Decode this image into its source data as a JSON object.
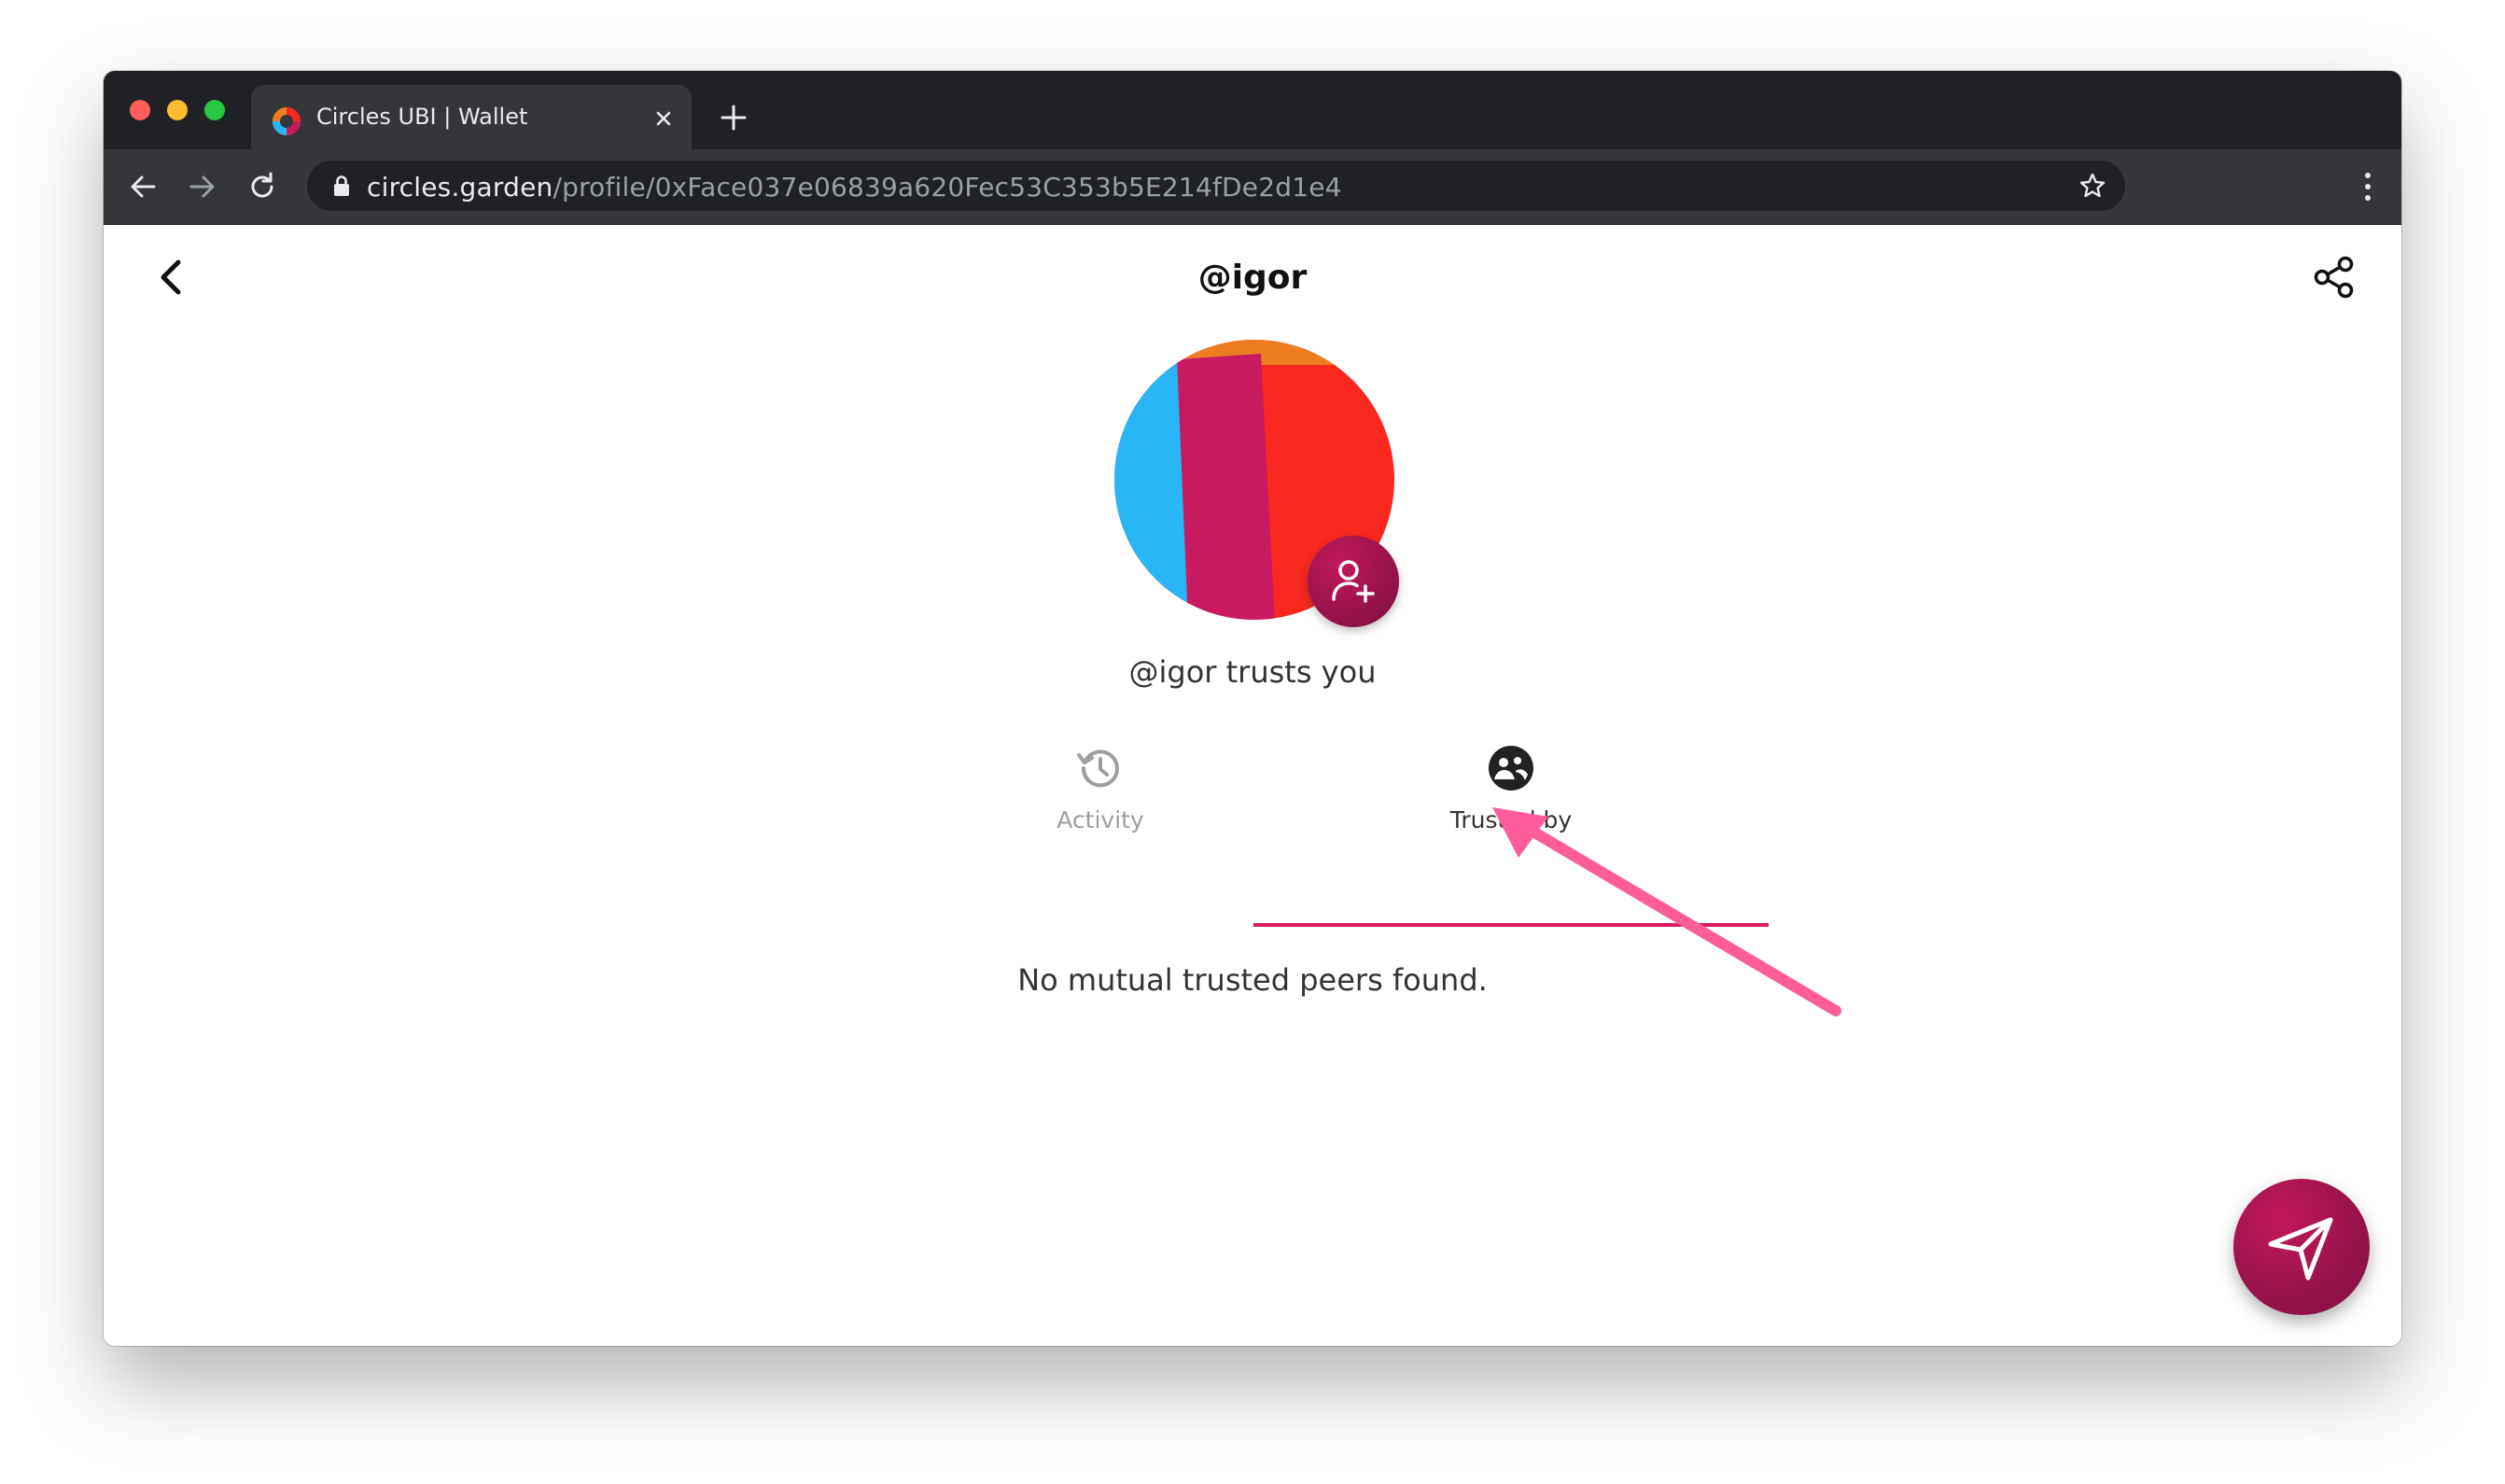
{
  "browser": {
    "tab_title": "Circles UBI | Wallet",
    "url_host": "circles.garden",
    "url_path": "/profile/0xFace037e06839a620Fec53C353b5E214fDe2d1e4"
  },
  "header": {
    "title": "@igor"
  },
  "profile": {
    "trust_status": "@igor trusts you"
  },
  "tabs": [
    {
      "label": "Activity",
      "icon": "history-icon",
      "active": false
    },
    {
      "label": "Trusted by",
      "icon": "people-icon",
      "active": true
    }
  ],
  "main": {
    "empty_message": "No mutual trusted peers found."
  },
  "colors": {
    "accent": "#d81b60",
    "fab": "#9c1550",
    "annotation_arrow": "#ff5c9b",
    "avatar_blue": "#29b6f6",
    "avatar_magenta": "#c81a5e",
    "avatar_red": "#f8281f",
    "avatar_orange": "#ee7d22"
  }
}
